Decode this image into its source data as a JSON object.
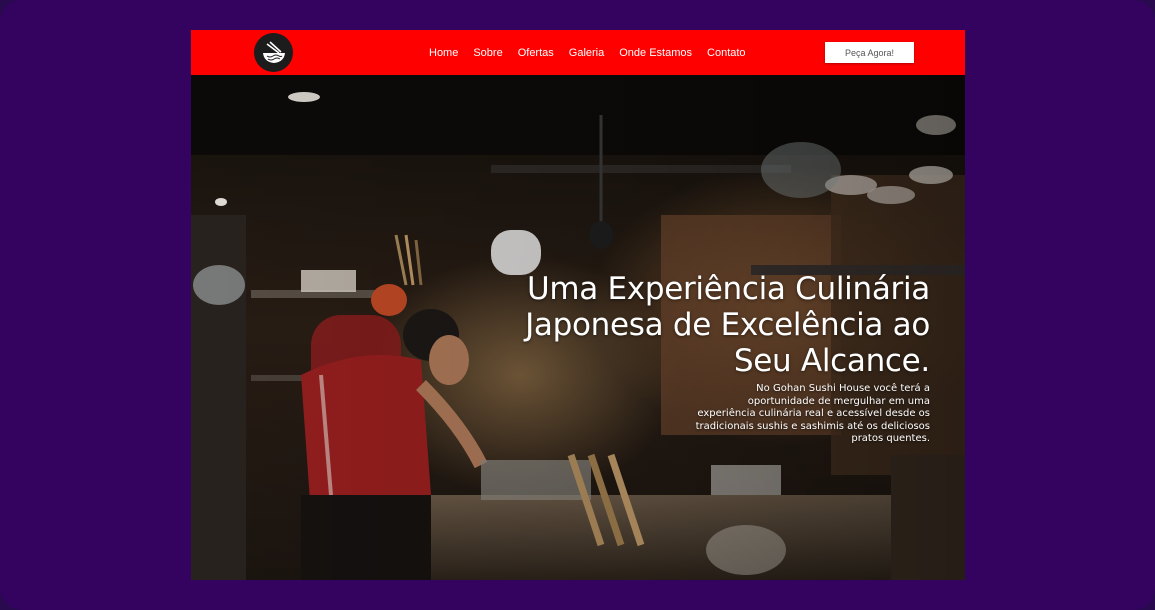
{
  "brand": {
    "logo_icon": "ramen-bowl-icon"
  },
  "nav": {
    "links": [
      "Home",
      "Sobre",
      "Ofertas",
      "Galeria",
      "Onde Estamos",
      "Contato"
    ],
    "cta_label": "Peça Agora!"
  },
  "hero": {
    "title": "Uma Experiência Culinária Japonesa de Excelência ao Seu Alcance.",
    "description": "No Gohan Sushi House você terá a oportunidade de mergulhar em uma experiência culinária real e acessível  desde os tradicionais sushis e sashimis até os deliciosos pratos quentes.",
    "background_image": "restaurant-kitchen-chef-photo"
  },
  "colors": {
    "navbar": "#ff0000",
    "frame": "#34035f",
    "cta_bg": "#ffffff",
    "text": "#ffffff"
  }
}
